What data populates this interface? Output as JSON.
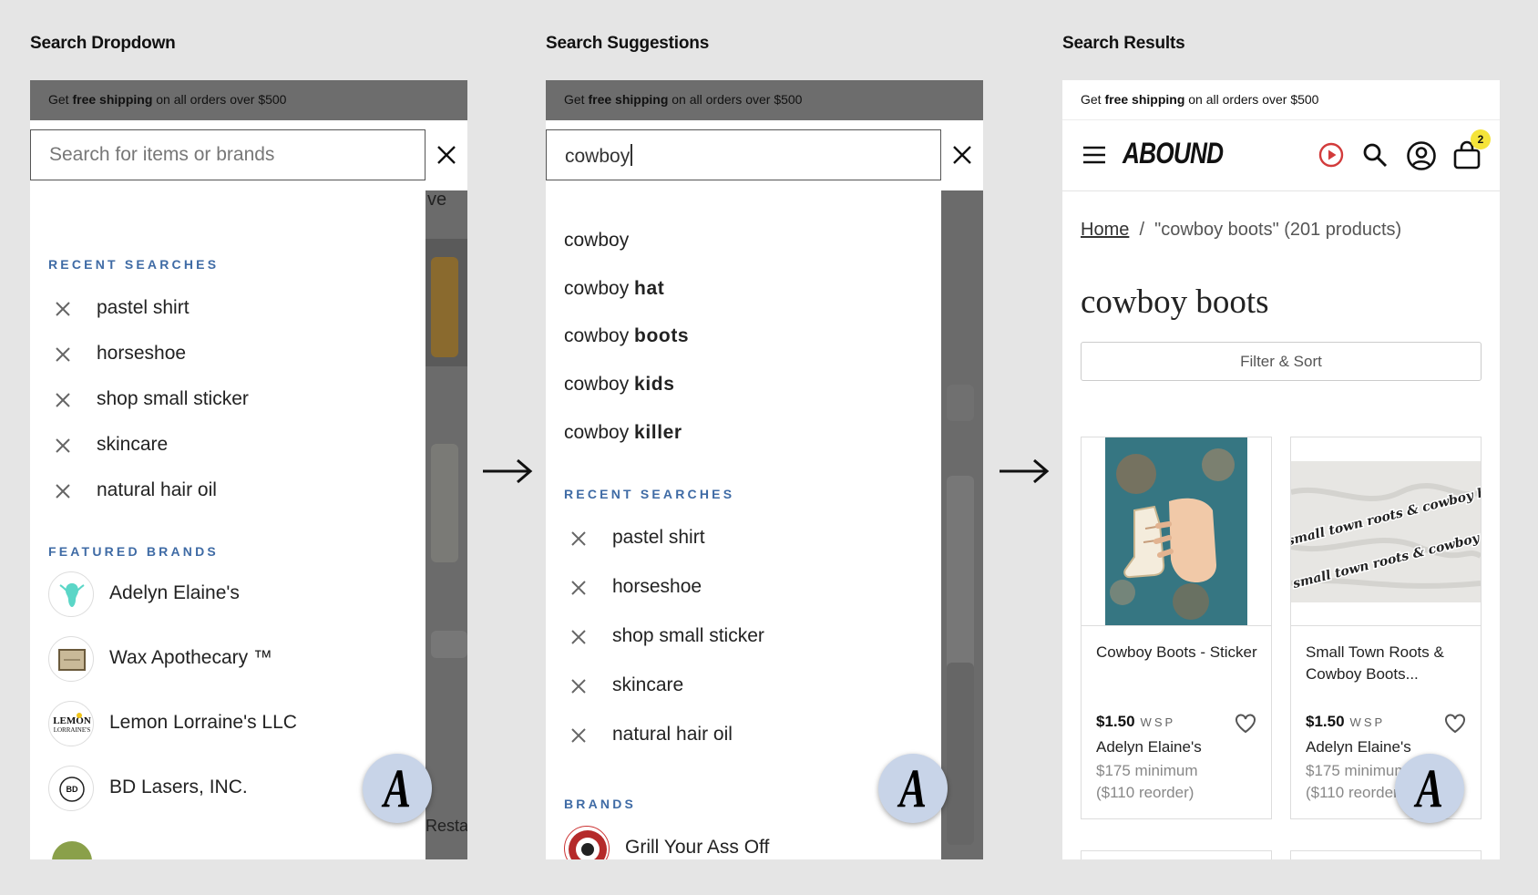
{
  "screens": [
    {
      "label": "Search Dropdown"
    },
    {
      "label": "Search Suggestions"
    },
    {
      "label": "Search Results"
    }
  ],
  "banner": {
    "pre": "Get ",
    "bold": "free shipping",
    "post": " on all orders over $500"
  },
  "dropdown": {
    "placeholder": "Search for items or brands",
    "recent_title": "RECENT SEARCHES",
    "recent": [
      "pastel shirt",
      "horseshoe",
      "shop small sticker",
      "skincare",
      "natural hair oil"
    ],
    "featured_title": "FEATURED BRANDS",
    "brands": [
      "Adelyn Elaine's",
      "Wax Apothecary ™",
      "Lemon Lorraine's LLC",
      "BD Lasers, INC."
    ],
    "bg_fragments": [
      "ve",
      "Resta"
    ]
  },
  "suggestions": {
    "query": "cowboy",
    "items": [
      {
        "base": "cowboy",
        "bold": ""
      },
      {
        "base": "cowboy ",
        "bold": "hat"
      },
      {
        "base": "cowboy ",
        "bold": "boots"
      },
      {
        "base": "cowboy ",
        "bold": "kids"
      },
      {
        "base": "cowboy ",
        "bold": "killer"
      }
    ],
    "recent_title": "RECENT SEARCHES",
    "recent": [
      "pastel shirt",
      "horseshoe",
      "shop small sticker",
      "skincare",
      "natural hair oil"
    ],
    "brands_title": "BRANDS",
    "brands": [
      "Grill Your Ass Off"
    ]
  },
  "results": {
    "logo": "ABOUND",
    "cart_count": "2",
    "breadcrumb_home": "Home",
    "breadcrumb_sep": "/",
    "breadcrumb_current": "\"cowboy boots\" (201 products)",
    "title": "cowboy boots",
    "filter_label": "Filter & Sort",
    "products": [
      {
        "name": "Cowboy Boots - Sticker",
        "price": "$1.50",
        "wsp": "WSP",
        "brand": "Adelyn Elaine's",
        "minimum": "$175 minimum",
        "reorder": "($110 reorder)"
      },
      {
        "name": "Small Town Roots & Cowboy Boots...",
        "price": "$1.50",
        "wsp": "WSP",
        "brand": "Adelyn Elaine's",
        "minimum": "$175 minimum",
        "reorder": "($110 reorder)",
        "sticker_text": "small town roots & cowboy boots"
      }
    ]
  },
  "fab_letter": "A",
  "colors": {
    "accent": "#3f6ba5",
    "fab": "#c8d4e8",
    "badge": "#f5e43a",
    "play": "#d23b3b"
  }
}
